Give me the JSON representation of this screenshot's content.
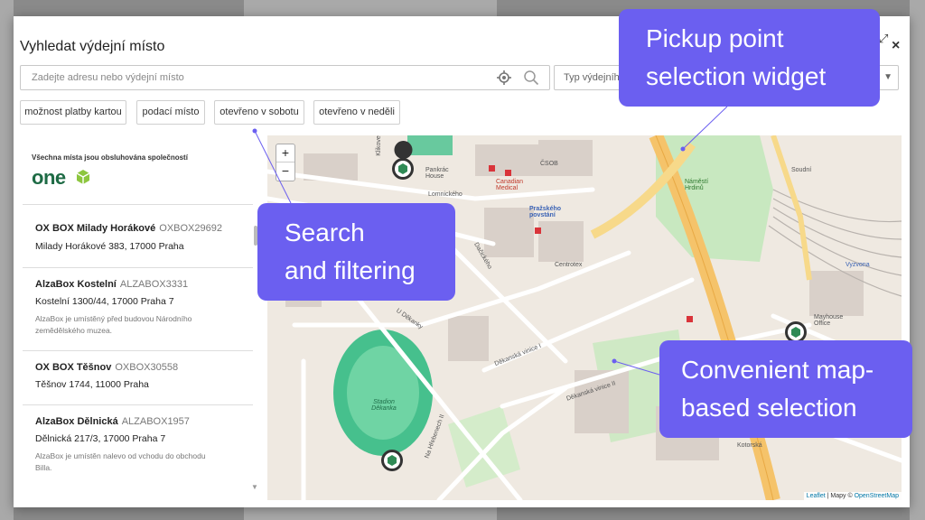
{
  "modal": {
    "title": "Vyhledat výdejní místo",
    "search_placeholder": "Zadejte adresu nebo výdejní místo",
    "type_select_label": "Typ výdejního",
    "filters": [
      "možnost platby kartou",
      "podací místo",
      "otevřeno v sobotu",
      "otevřeno v neděli"
    ]
  },
  "list": {
    "header": "Všechna místa jsou obsluhována společností",
    "logo_text": "one",
    "items": [
      {
        "name": "OX BOX Milady Horákové",
        "code": "OXBOX29692",
        "address": "Milady Horákové 383, 17000 Praha",
        "note": ""
      },
      {
        "name": "AlzaBox Kostelní",
        "code": "ALZABOX3331",
        "address": "Kostelní 1300/44, 17000 Praha 7",
        "note": "AlzaBox je umístěný před budovou Národního zemědělského muzea."
      },
      {
        "name": "OX BOX Těšnov",
        "code": "OXBOX30558",
        "address": "Těšnov 1744, 11000 Praha",
        "note": ""
      },
      {
        "name": "AlzaBox Dělnická",
        "code": "ALZABOX1957",
        "address": "Dělnická 217/3, 17000 Praha 7",
        "note": "AlzaBox je umístěn nalevo od vchodu do obchodu Billa."
      }
    ]
  },
  "map": {
    "zoom_in": "+",
    "zoom_out": "−",
    "attribution_leaflet": "Leaflet",
    "attribution_sep": " | Mapy © ",
    "attribution_osm": "OpenStreetMap",
    "labels": {
      "klikovce": "Klikove",
      "lomnickeho": "Lomnického",
      "pankrac_house": "Pankrác House",
      "canadian_medical": "Canadian Medical",
      "csob": "ČSOB",
      "prazskeho_povstani": "Pražského povstání",
      "namesti_hrdinu": "Náměstí Hrdinů",
      "namesti_hrdinu_2": "Náměstí Hrdinů",
      "centrotex": "Centrotex",
      "dacickeho": "Dačického",
      "kotorska": "Kotorská",
      "u_dekanky": "U Děkanky",
      "stadion_dekanka": "Stadion Děkanka",
      "dekanska_vinice": "Děkanská vinice I",
      "dekanska_vinice_2": "Děkanská vinice II",
      "na_hrebenech": "Na Hřebenech II",
      "mayhouse_office": "Mayhouse Office",
      "soudni": "Soudní",
      "vyzkumna": "Vyzvona"
    }
  },
  "callouts": {
    "widget": [
      "Pickup point",
      "selection widget"
    ],
    "search": [
      "Search",
      "and filtering"
    ],
    "map": [
      "Convenient map-",
      "based selection"
    ]
  },
  "colors": {
    "callout": "#6b5ff0",
    "brand_green": "#1e6b45",
    "map_road_major": "#f5c36a",
    "map_park": "#c8e8c0",
    "map_stadium": "#46c08d"
  }
}
